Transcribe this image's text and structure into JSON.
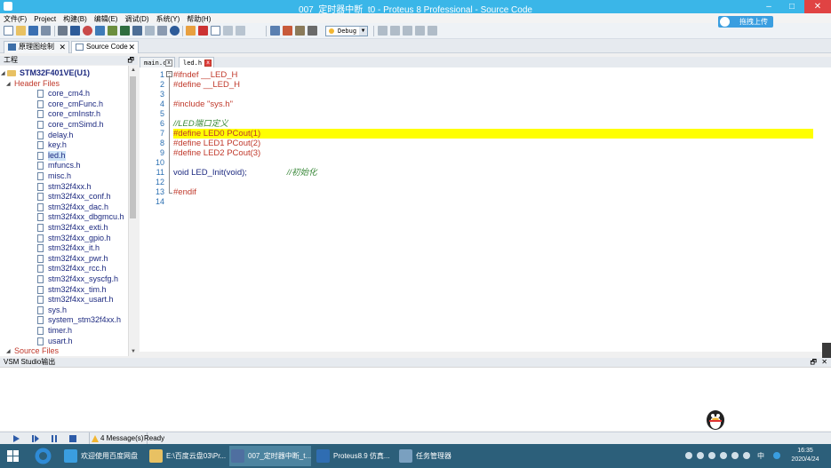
{
  "window": {
    "title": "007_定时器中断_t0 - Proteus 8 Professional - Source Code",
    "minimize": "–",
    "maximize": "□",
    "close": "✕"
  },
  "menu": [
    "文件(F)",
    "Project",
    "构建(B)",
    "编辑(E)",
    "调试(D)",
    "系统(Y)",
    "帮助(H)"
  ],
  "toolbar": {
    "debug_combo": "Debug",
    "upload_button": "拖拽上传"
  },
  "doc_tabs": [
    {
      "label": "原理图绘制",
      "close": "✕"
    },
    {
      "label": "Source Code",
      "close": "✕"
    }
  ],
  "project_pane": {
    "title": "工程",
    "pin": "🗗",
    "tree": [
      {
        "level": 0,
        "kind": "root",
        "label": "STM32F401VE(U1)"
      },
      {
        "level": 1,
        "kind": "group",
        "label": "Header Files"
      },
      {
        "level": 2,
        "kind": "item",
        "label": "core_cm4.h"
      },
      {
        "level": 2,
        "kind": "item",
        "label": "core_cmFunc.h"
      },
      {
        "level": 2,
        "kind": "item",
        "label": "core_cmInstr.h"
      },
      {
        "level": 2,
        "kind": "item",
        "label": "core_cmSimd.h"
      },
      {
        "level": 2,
        "kind": "item",
        "label": "delay.h"
      },
      {
        "level": 2,
        "kind": "item",
        "label": "key.h"
      },
      {
        "level": 2,
        "kind": "item",
        "label": "led.h",
        "selected": true
      },
      {
        "level": 2,
        "kind": "item",
        "label": "mfuncs.h"
      },
      {
        "level": 2,
        "kind": "item",
        "label": "misc.h"
      },
      {
        "level": 2,
        "kind": "item",
        "label": "stm32f4xx.h"
      },
      {
        "level": 2,
        "kind": "item",
        "label": "stm32f4xx_conf.h"
      },
      {
        "level": 2,
        "kind": "item",
        "label": "stm32f4xx_dac.h"
      },
      {
        "level": 2,
        "kind": "item",
        "label": "stm32f4xx_dbgmcu.h"
      },
      {
        "level": 2,
        "kind": "item",
        "label": "stm32f4xx_exti.h"
      },
      {
        "level": 2,
        "kind": "item",
        "label": "stm32f4xx_gpio.h"
      },
      {
        "level": 2,
        "kind": "item",
        "label": "stm32f4xx_it.h"
      },
      {
        "level": 2,
        "kind": "item",
        "label": "stm32f4xx_pwr.h"
      },
      {
        "level": 2,
        "kind": "item",
        "label": "stm32f4xx_rcc.h"
      },
      {
        "level": 2,
        "kind": "item",
        "label": "stm32f4xx_syscfg.h"
      },
      {
        "level": 2,
        "kind": "item",
        "label": "stm32f4xx_tim.h"
      },
      {
        "level": 2,
        "kind": "item",
        "label": "stm32f4xx_usart.h"
      },
      {
        "level": 2,
        "kind": "item",
        "label": "sys.h"
      },
      {
        "level": 2,
        "kind": "item",
        "label": "system_stm32f4xx.h"
      },
      {
        "level": 2,
        "kind": "item",
        "label": "timer.h"
      },
      {
        "level": 2,
        "kind": "item",
        "label": "usart.h"
      },
      {
        "level": 1,
        "kind": "group",
        "label": "Source Files"
      }
    ]
  },
  "editor": {
    "tabs": [
      {
        "label": "main.c",
        "close": "x"
      },
      {
        "label": "led.h",
        "close": "x",
        "active": true
      }
    ],
    "highlight_line": 7,
    "lines": [
      {
        "n": "1",
        "segs": [
          {
            "t": "#ifndef __LED_H",
            "c": "dir"
          }
        ]
      },
      {
        "n": "2",
        "segs": [
          {
            "t": "#define __LED_H",
            "c": "dir"
          }
        ]
      },
      {
        "n": "3",
        "segs": []
      },
      {
        "n": "4",
        "segs": [
          {
            "t": "#include \"sys.h\"",
            "c": "str"
          }
        ]
      },
      {
        "n": "5",
        "segs": []
      },
      {
        "n": "6",
        "segs": [
          {
            "t": "//LED端口定义",
            "c": "cmt"
          }
        ]
      },
      {
        "n": "7",
        "segs": [
          {
            "t": "#define LED0 PCout(1)",
            "c": "dir"
          }
        ]
      },
      {
        "n": "8",
        "segs": [
          {
            "t": "#define LED1 PCout(2)",
            "c": "dir"
          }
        ]
      },
      {
        "n": "9",
        "segs": [
          {
            "t": "#define LED2 PCout(3)",
            "c": "dir"
          }
        ]
      },
      {
        "n": "10",
        "segs": []
      },
      {
        "n": "11",
        "segs": [
          {
            "t": "void ",
            "c": "kw"
          },
          {
            "t": "LED_Init(void);",
            "c": "fn"
          },
          {
            "t": "                 ",
            "c": "kw"
          },
          {
            "t": "//初始化",
            "c": "cmt"
          }
        ]
      },
      {
        "n": "12",
        "segs": []
      },
      {
        "n": "13",
        "segs": [
          {
            "t": "#endif",
            "c": "dir"
          }
        ]
      },
      {
        "n": "14",
        "segs": []
      }
    ]
  },
  "output_pane": {
    "title": "VSM Studio输出",
    "pin": "🗗",
    "close": "✕"
  },
  "statusbar": {
    "messages": "4 Message(s)",
    "ready": "Ready"
  },
  "taskbar": {
    "items": [
      {
        "label": "欢迎使用百度网盘",
        "color": "#3a9ee0"
      },
      {
        "label": "E:\\百度云盘03\\Pr...",
        "color": "#e8c163"
      },
      {
        "label": "007_定时器中断_t...",
        "color": "#4f6fa0",
        "active": true
      },
      {
        "label": "Proteus8.9 仿真...",
        "color": "#2f6db2"
      },
      {
        "label": "任务管理器",
        "color": "#7aa0c0"
      }
    ],
    "ime": "中",
    "time": "16:35",
    "date": "2020/4/24"
  }
}
